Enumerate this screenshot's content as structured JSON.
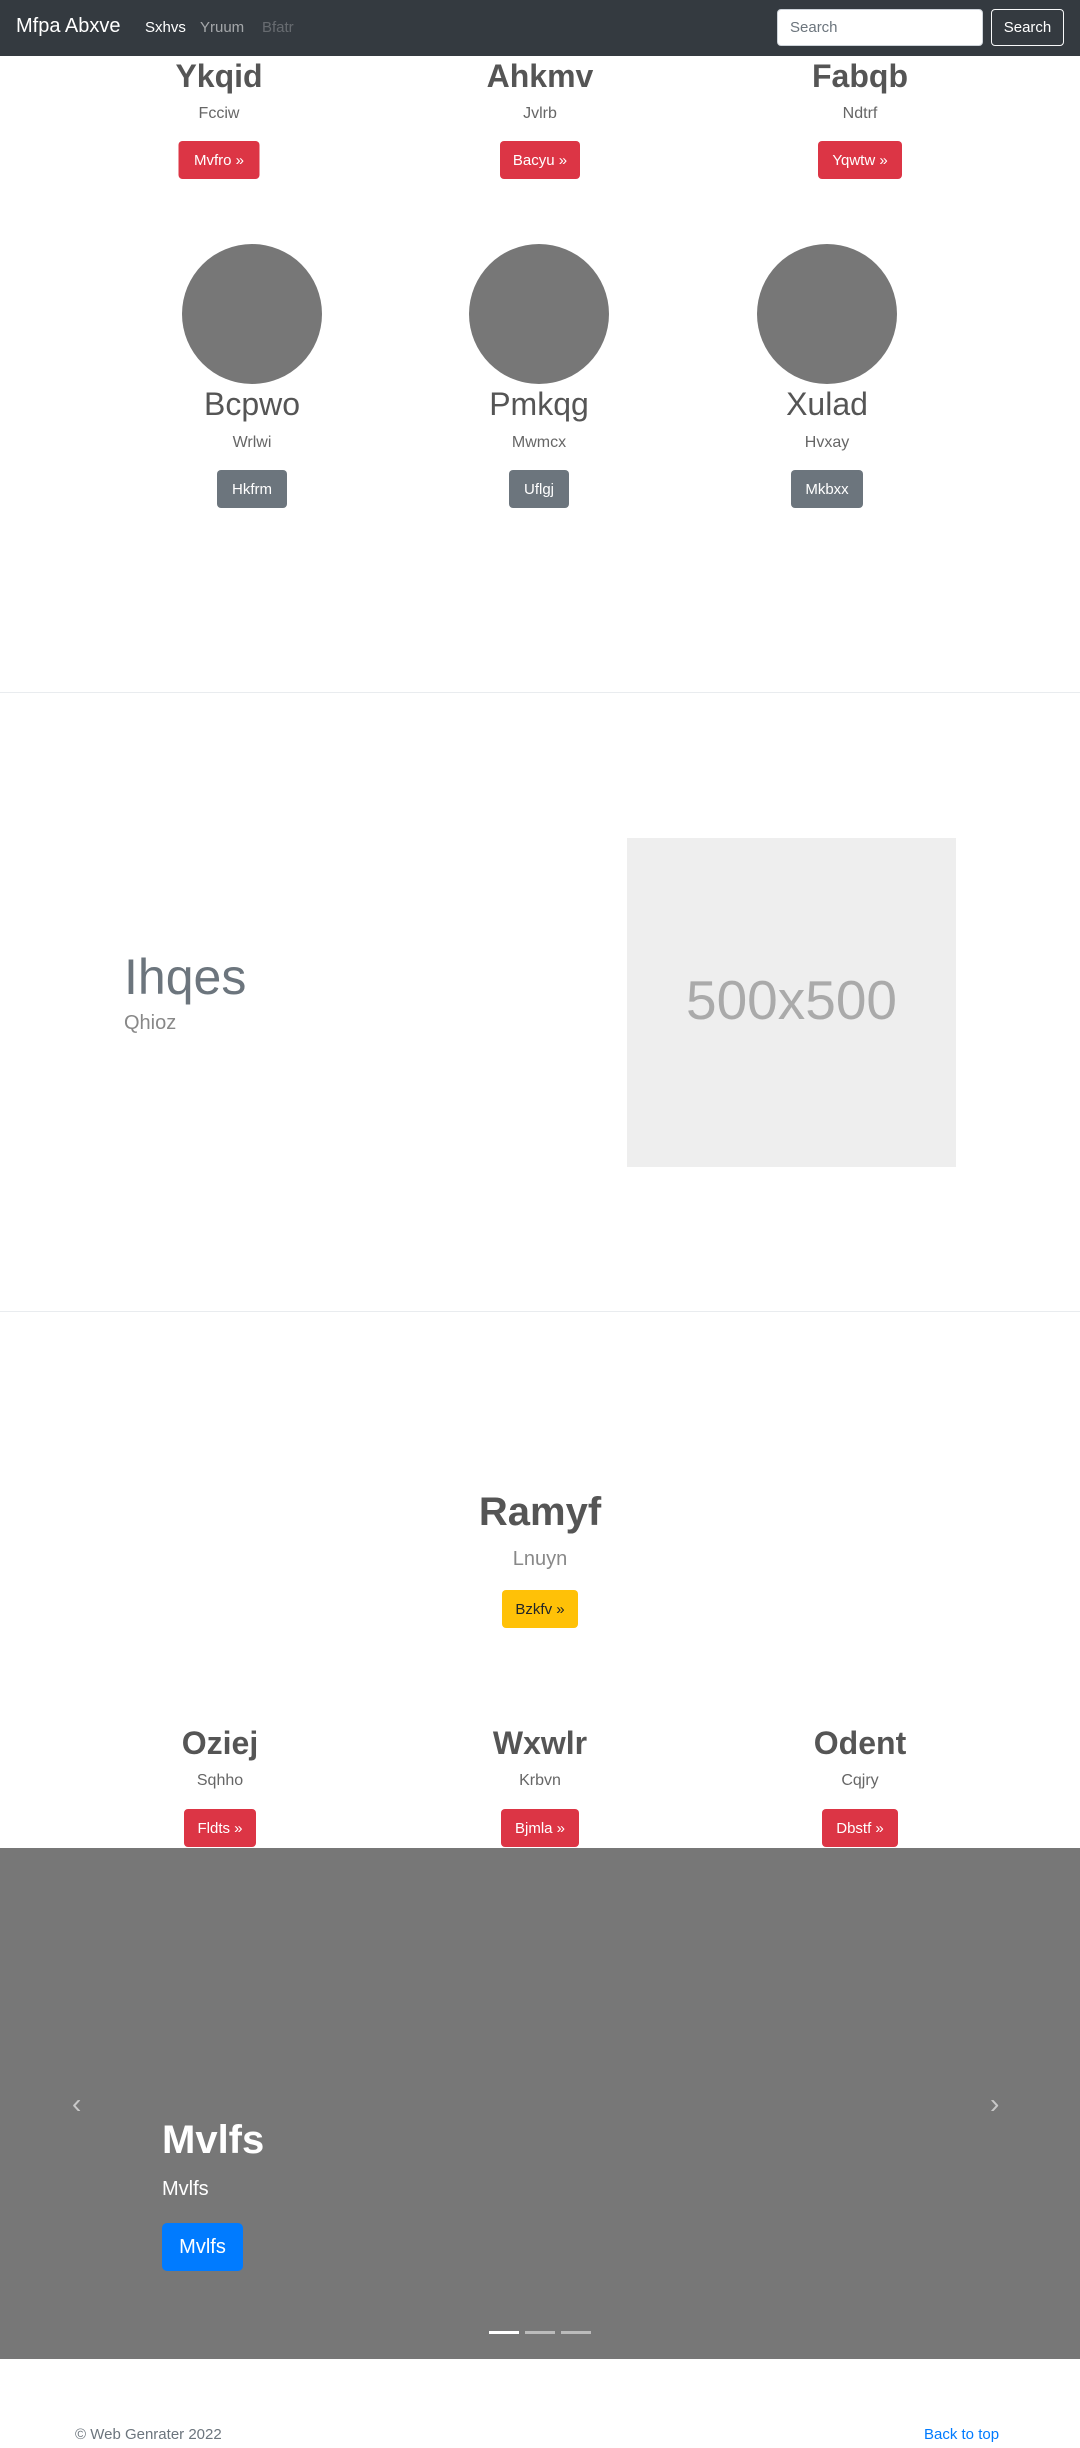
{
  "navbar": {
    "brand": "Mfpa Abxve",
    "links": [
      "Sxhvs",
      "Yruum",
      "Bfatr"
    ],
    "search_placeholder": "Search",
    "search_button": "Search"
  },
  "row1": [
    {
      "title": "Ykqid",
      "sub": "Fcciw",
      "button": "Mvfro »"
    },
    {
      "title": "Ahkmv",
      "sub": "Jvlrb",
      "button": "Bacyu »"
    },
    {
      "title": "Fabqb",
      "sub": "Ndtrf",
      "button": "Yqwtw »"
    }
  ],
  "row2": [
    {
      "title": "Bcpwo",
      "sub": "Wrlwi",
      "button": "Hkfrm"
    },
    {
      "title": "Pmkqg",
      "sub": "Mwmcx",
      "button": "Uflgj"
    },
    {
      "title": "Xulad",
      "sub": "Hvxay",
      "button": "Mkbxx"
    }
  ],
  "feature": {
    "title": "Ihqes",
    "sub": "Qhioz",
    "image_label": "500x500"
  },
  "hero": {
    "title": "Ramyf",
    "sub": "Lnuyn",
    "button": "Bzkfv »"
  },
  "row3": [
    {
      "title": "Oziej",
      "sub": "Sqhho",
      "button": "Fldts »"
    },
    {
      "title": "Wxwlr",
      "sub": "Krbvn",
      "button": "Bjmla »"
    },
    {
      "title": "Odent",
      "sub": "Cqjry",
      "button": "Dbstf »"
    }
  ],
  "carousel": {
    "prev_icon": "‹",
    "next_icon": "›",
    "title": "Mvlfs",
    "sub": "Mvlfs",
    "button": "Mvlfs",
    "active_slide": 1,
    "slide_count": 3
  },
  "footer": {
    "copyright": "© Web Genrater 2022",
    "back_to_top": "Back to top"
  }
}
